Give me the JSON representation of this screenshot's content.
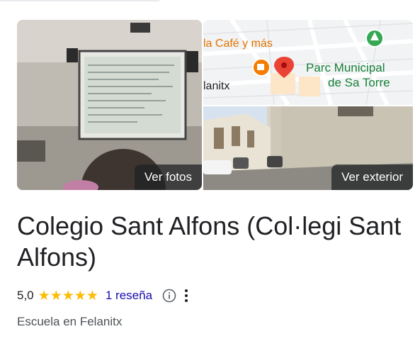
{
  "gallery": {
    "photos_label": "Ver fotos",
    "exterior_label": "Ver exterior",
    "map": {
      "cafe_label": "la Café y más",
      "park_label_line1": "Parc Municipal",
      "park_label_line2": "de Sa Torre",
      "town_label": "lanitx"
    }
  },
  "place": {
    "title": "Colegio Sant Alfons (Col·legi Sant Alfons)",
    "rating": "5,0",
    "stars": 5,
    "reviews_link": "1 reseña",
    "category": "Escuela en Felanitx"
  },
  "colors": {
    "star": "#fbbc04",
    "link": "#1a0dab",
    "pin": "#ea4335",
    "park_icon": "#34a853",
    "cafe_icon": "#f57c00"
  }
}
